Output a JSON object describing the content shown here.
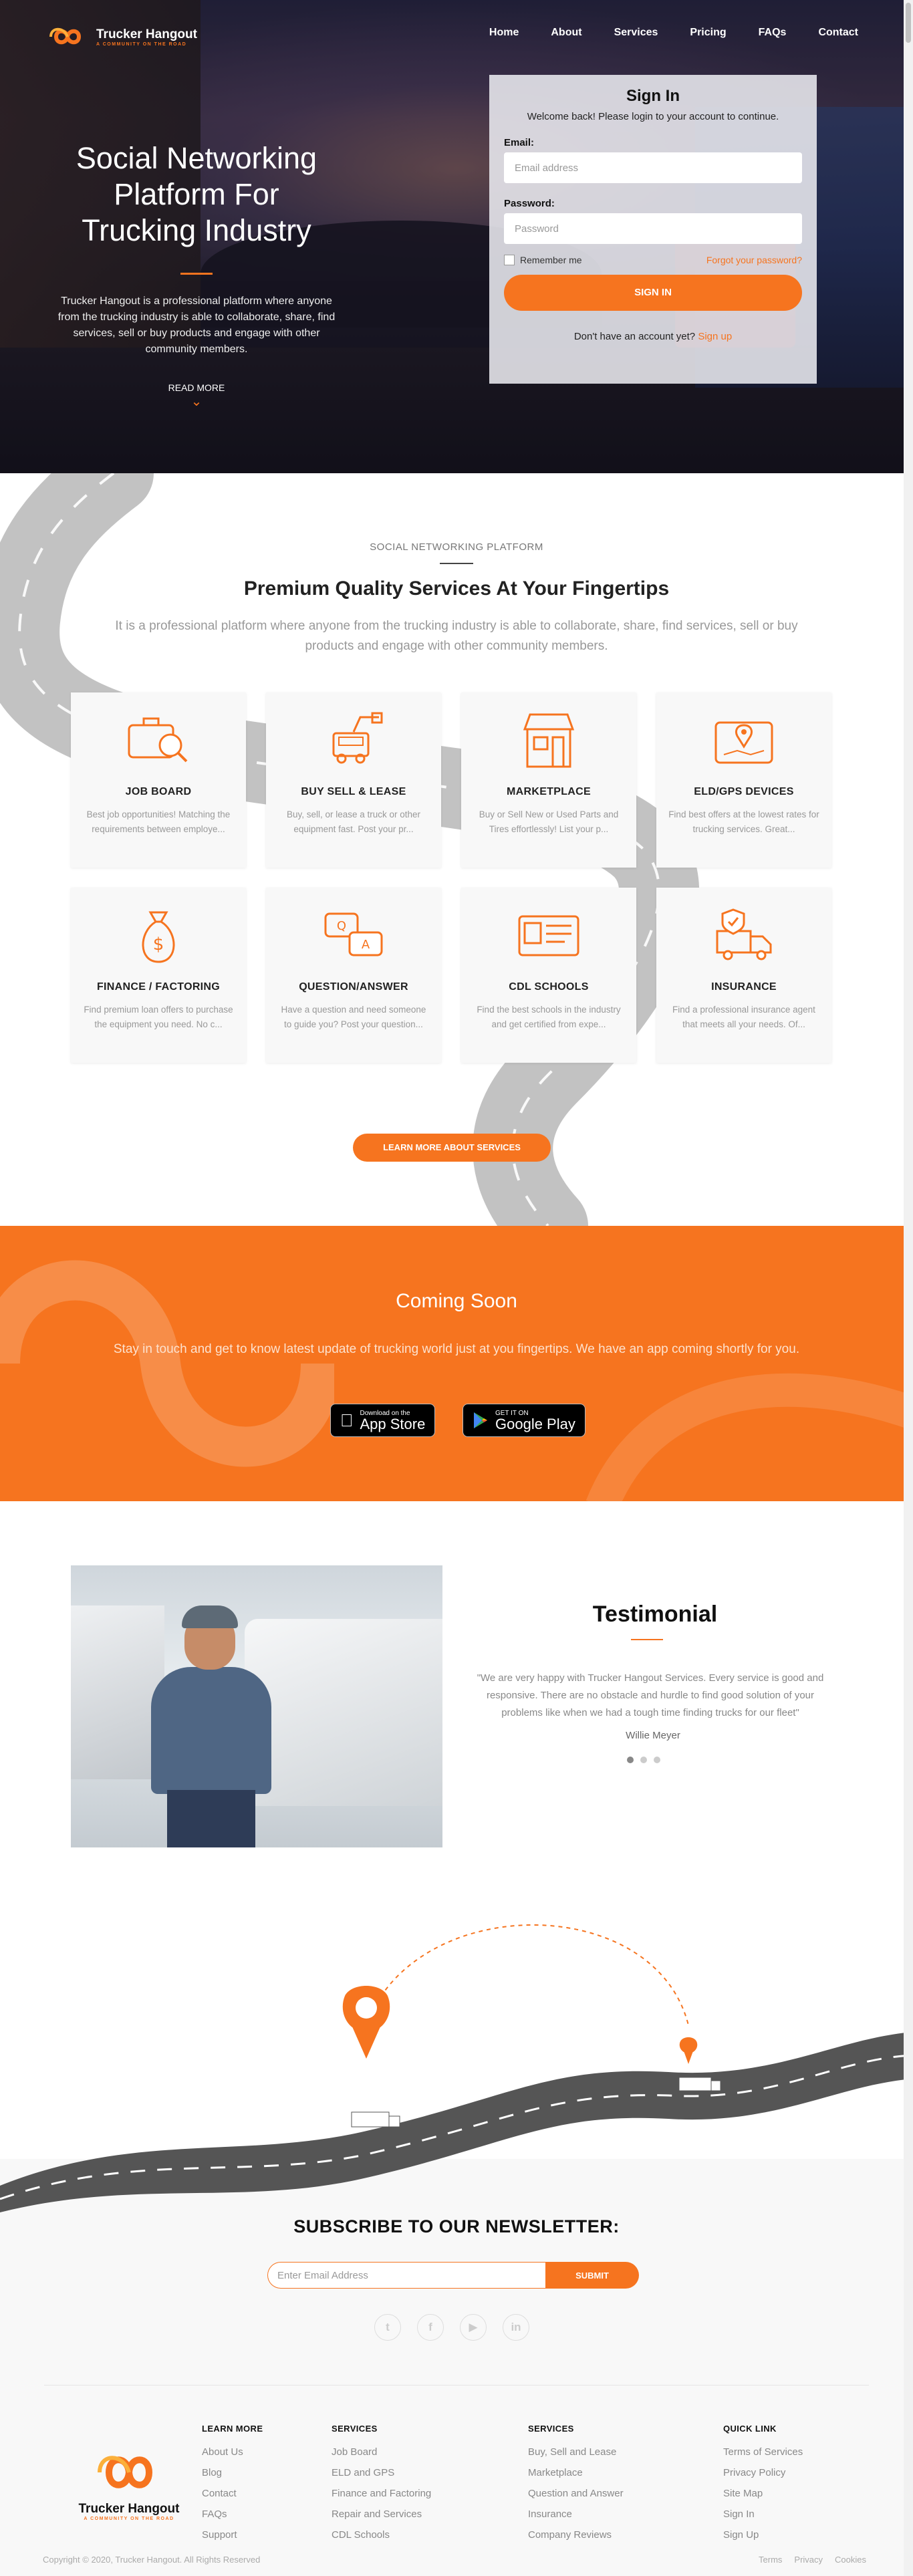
{
  "brand": {
    "name": "Trucker Hangout",
    "tagline": "A COMMUNITY ON THE ROAD",
    "accent": "#f6741f"
  },
  "nav": [
    "Home",
    "About",
    "Services",
    "Pricing",
    "FAQs",
    "Contact"
  ],
  "hero": {
    "title": "Social Networking Platform For Trucking Industry",
    "text": "Trucker Hangout is a professional platform where anyone from the trucking industry is able to collaborate, share, find services, sell or buy products and engage with other community members.",
    "read_more": "READ MORE"
  },
  "signin": {
    "title": "Sign In",
    "welcome": "Welcome back! Please login to your account to continue.",
    "email_label": "Email:",
    "email_placeholder": "Email address",
    "password_label": "Password:",
    "password_placeholder": "Password",
    "remember": "Remember me",
    "forgot": "Forgot your password?",
    "button": "SIGN IN",
    "no_account": "Don't have an account yet?",
    "signup": "Sign up"
  },
  "services": {
    "kicker": "SOCIAL NETWORKING PLATFORM",
    "title": "Premium Quality Services At Your Fingertips",
    "subtitle": "It is a professional platform where anyone from the trucking industry is able to collaborate, share, find services, sell or buy products and engage with other community members.",
    "cards": [
      {
        "icon": "briefcase-search-icon",
        "title": "JOB BOARD",
        "text": "Best job opportunities! Matching the requirements between employe..."
      },
      {
        "icon": "truck-lift-icon",
        "title": "BUY SELL & LEASE",
        "text": "Buy, sell, or lease a truck or other equipment fast. Post your pr..."
      },
      {
        "icon": "storefront-icon",
        "title": "MARKETPLACE",
        "text": "Buy or Sell New or Used Parts and Tires effortlessly! List your p..."
      },
      {
        "icon": "gps-device-icon",
        "title": "ELD/GPS DEVICES",
        "text": "Find best offers at the lowest rates for trucking services. Great..."
      },
      {
        "icon": "money-bag-icon",
        "title": "FINANCE / FACTORING",
        "text": "Find premium loan offers to purchase the equipment you need. No c..."
      },
      {
        "icon": "question-answer-icon",
        "title": "QUESTION/ANSWER",
        "text": "Have a question and need someone to guide you? Post your question..."
      },
      {
        "icon": "license-card-icon",
        "title": "CDL SCHOOLS",
        "text": "Find the best schools in the industry and get certified from expe..."
      },
      {
        "icon": "insured-truck-icon",
        "title": "INSURANCE",
        "text": "Find a professional insurance agent that meets all your needs. Of..."
      }
    ],
    "button": "LEARN MORE ABOUT SERVICES"
  },
  "coming": {
    "title": "Coming Soon",
    "text": "Stay in touch and get to know latest update of trucking world just at you fingertips. We have an app coming shortly for you.",
    "appstore_small": "Download on the",
    "appstore_big": "App Store",
    "google_small": "GET IT ON",
    "google_big": "Google Play"
  },
  "testimonial": {
    "title": "Testimonial",
    "quote": "\"We are very happy with Trucker Hangout Services. Every service is good and responsive. There are no obstacle and hurdle to find good solution of your problems like when we had a tough time finding trucks for our fleet\"",
    "author": "Willie Meyer"
  },
  "newsletter": {
    "title": "SUBSCRIBE TO OUR NEWSLETTER:",
    "placeholder": "Enter Email Address",
    "button": "SUBMIT"
  },
  "socials": [
    "twitter-icon",
    "facebook-icon",
    "youtube-icon",
    "linkedin-icon"
  ],
  "footer": {
    "cols": [
      {
        "title": "LEARN MORE",
        "links": [
          "About Us",
          "Blog",
          "Contact",
          "FAQs",
          "Support"
        ]
      },
      {
        "title": "SERVICES",
        "links": [
          "Job Board",
          "ELD and GPS",
          "Finance and Factoring",
          "Repair and Services",
          "CDL Schools"
        ]
      },
      {
        "title": "SERVICES",
        "links": [
          "Buy, Sell and Lease",
          "Marketplace",
          "Question and Answer",
          "Insurance",
          "Company Reviews"
        ]
      },
      {
        "title": "QUICK LINK",
        "links": [
          "Terms of Services",
          "Privacy Policy",
          "Site Map",
          "Sign In",
          "Sign Up"
        ]
      }
    ],
    "copyright": "Copyright © 2020, Trucker Hangout. All Rights Reserved",
    "legal": [
      "Terms",
      "Privacy",
      "Cookies"
    ]
  }
}
